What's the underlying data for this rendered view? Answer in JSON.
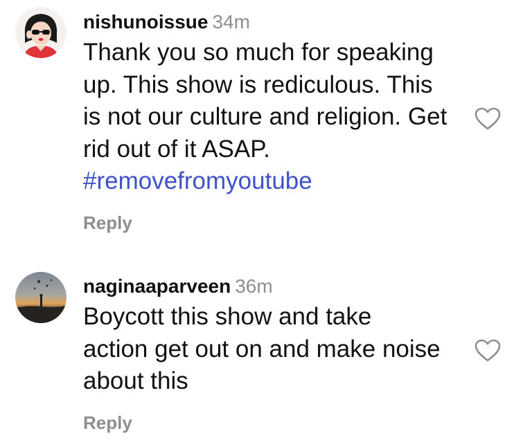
{
  "comments": [
    {
      "username": "nishunoissue",
      "time": "34m",
      "lines": [
        "Thank you so much for speaking",
        "up. This show is rediculous. This",
        "is not our culture and religion. Get",
        "rid out of it ASAP."
      ],
      "hashtag": "#removefromyoutube",
      "reply_label": "Reply",
      "avatar_icon": "cartoon-woman-sunglasses-avatar",
      "like_icon": "heart-outline-icon"
    },
    {
      "username": "naginaaparveen",
      "time": "36m",
      "lines": [
        "Boycott this show and take",
        "action get out on and make noise",
        "about this"
      ],
      "reply_label": "Reply",
      "avatar_icon": "sunset-balloons-photo-avatar",
      "like_icon": "heart-outline-icon"
    }
  ],
  "colors": {
    "text": "#111111",
    "muted": "#8e8e8e",
    "hashtag": "#3f51c9"
  }
}
